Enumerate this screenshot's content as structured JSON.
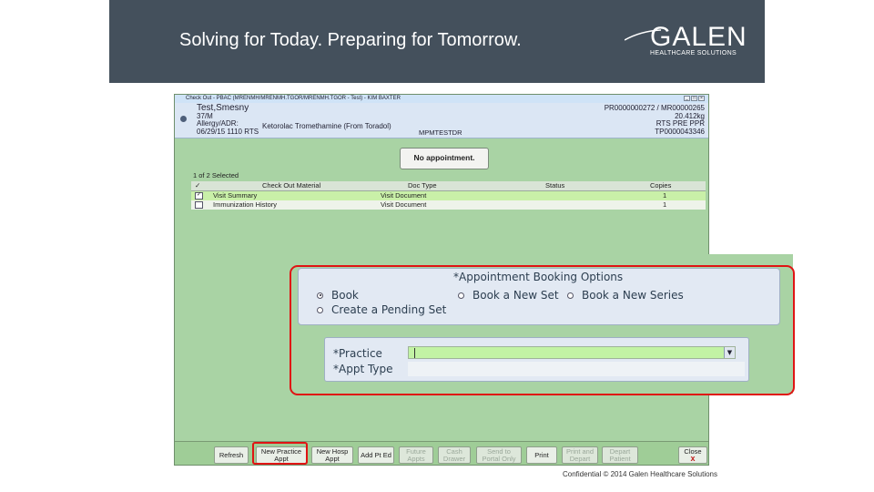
{
  "banner": {
    "tagline": "Solving for Today. Preparing for Tomorrow.",
    "logo_word": "GALEN",
    "logo_sub": "HEALTHCARE SOLUTIONS"
  },
  "window": {
    "title": "Check Out - PBAC (MRENMH/MRENMH.TGOR/MRENMH.TGOR - Test) - KIM BAXTER"
  },
  "patient": {
    "name": "Test,Smesny",
    "age_sex": "37/M",
    "allergy_label": "Allergy/ADR:",
    "allergy_value": "Ketorolac Tromethamine (From Toradol)",
    "date_line": "06/29/15 1110 RTS",
    "provider": "MPMTESTDR",
    "account": "PR0000000272 / MR00000265",
    "weight": "20.412kg",
    "location": "RTS PRE PPR",
    "encounter": "TP0000043346"
  },
  "no_appointment_label": "No appointment.",
  "selection_count": "1 of 2 Selected",
  "grid": {
    "headers": {
      "check": "✓",
      "material": "Check Out Material",
      "doc_type": "Doc Type",
      "status": "Status",
      "copies": "Copies"
    },
    "rows": [
      {
        "checked": "✓",
        "material": "Visit Summary",
        "doc_type": "Visit Document",
        "status": "",
        "copies": "1"
      },
      {
        "checked": "",
        "material": "Immunization History",
        "doc_type": "Visit Document",
        "status": "",
        "copies": "1"
      }
    ]
  },
  "footer_buttons": {
    "refresh": "Refresh",
    "new_practice_appt": "New Practice Appt",
    "new_hosp_appt": "New Hosp Appt",
    "add_pt_ed": "Add Pt Ed",
    "future_appts": "Future Appts",
    "cash_drawer": "Cash Drawer",
    "send_portal": "Send to Portal Only",
    "print": "Print",
    "print_depart": "Print and Depart",
    "depart_patient": "Depart Patient",
    "close": "Close",
    "close_x": "x"
  },
  "booking": {
    "title": "*Appointment Booking Options",
    "opt_book": "Book",
    "opt_new_set": "Book a New Set",
    "opt_new_series": "Book a New Series",
    "opt_pending_set": "Create a Pending Set",
    "practice_label": "*Practice",
    "practice_value": "",
    "appt_type_label": "*Appt Type",
    "appt_type_value": ""
  },
  "confidential": "Confidential © 2014 Galen Healthcare Solutions"
}
